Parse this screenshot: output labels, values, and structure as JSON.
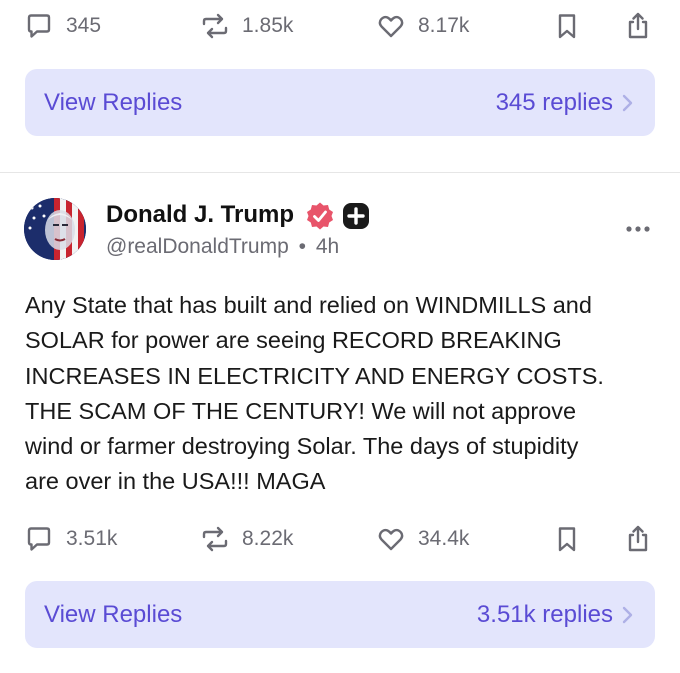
{
  "top_post": {
    "actions": {
      "comments": "345",
      "reposts": "1.85k",
      "likes": "8.17k"
    },
    "replies_bar": {
      "label": "View Replies",
      "count": "345 replies"
    }
  },
  "post": {
    "author": {
      "name": "Donald J. Trump",
      "handle": "@realDonaldTrump",
      "separator": "•",
      "time": "4h"
    },
    "text": "Any State that has built and relied on WINDMILLS and\nSOLAR for power are seeing RECORD BREAKING\nINCREASES IN ELECTRICITY AND ENERGY COSTS.\nTHE SCAM OF THE CENTURY! We will not approve\nwind or farmer destroying Solar. The days of stupidity\nare over in the USA!!! MAGA",
    "actions": {
      "comments": "3.51k",
      "reposts": "8.22k",
      "likes": "34.4k"
    },
    "replies_bar": {
      "label": "View Replies",
      "count": "3.51k replies"
    }
  },
  "icons": [
    "comment-icon",
    "repost-icon",
    "like-icon",
    "bookmark-icon",
    "share-icon",
    "verified-icon",
    "plus-badge-icon",
    "more-icon",
    "chevron-right-icon"
  ],
  "colors": {
    "accent": "#5a4bd4",
    "replies_bar_bg": "#e3e5fc",
    "verified": "#e8546a",
    "muted": "#6b6b73"
  }
}
